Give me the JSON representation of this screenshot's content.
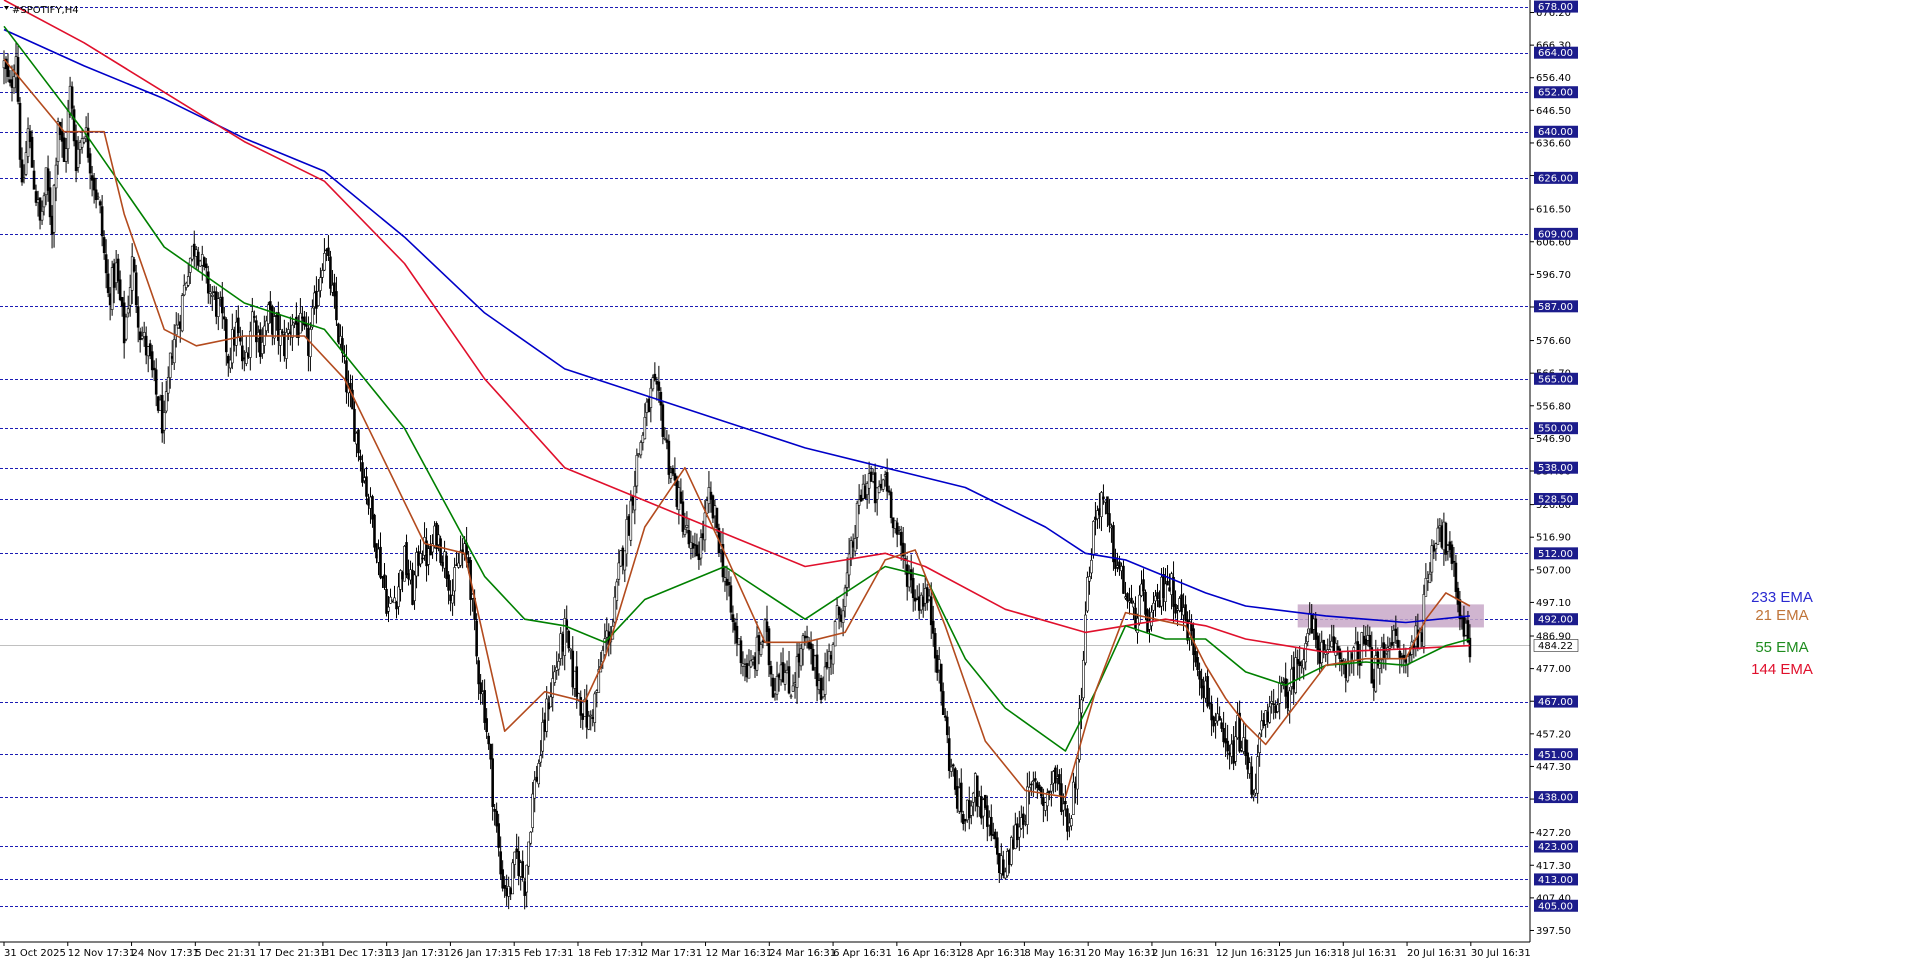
{
  "title": "#SPOTIFY,H4",
  "chart_data": {
    "type": "candlestick",
    "symbol": "#SPOTIFY",
    "timeframe": "H4",
    "ylim": [
      394.0,
      680.0
    ],
    "price_ticks": [
      "676.20",
      "666.30",
      "656.40",
      "646.50",
      "636.60",
      "626.70",
      "616.50",
      "606.60",
      "596.70",
      "586.80",
      "576.60",
      "566.70",
      "556.80",
      "546.90",
      "537.00",
      "526.80",
      "516.90",
      "507.00",
      "497.10",
      "486.90",
      "477.00",
      "467.10",
      "457.20",
      "447.30",
      "437.40",
      "427.20",
      "417.30",
      "407.40",
      "397.50"
    ],
    "x_labels": [
      "31 Oct 2025",
      "12 Nov 17:31",
      "24 Nov 17:31",
      "5 Dec 21:31",
      "17 Dec 21:31",
      "31 Dec 17:31",
      "13 Jan 17:31",
      "26 Jan 17:31",
      "5 Feb 17:31",
      "18 Feb 17:31",
      "2 Mar 17:31",
      "12 Mar 16:31",
      "24 Mar 16:31",
      "6 Apr 16:31",
      "16 Apr 16:31",
      "28 Apr 16:31",
      "8 May 16:31",
      "20 May 16:31",
      "2 Jun 16:31",
      "12 Jun 16:31",
      "25 Jun 16:31",
      "8 Jul 16:31",
      "20 Jul 16:31",
      "30 Jul 16:31"
    ],
    "horizontal_levels": [
      "678.00",
      "664.00",
      "652.00",
      "640.00",
      "626.00",
      "609.00",
      "587.00",
      "565.00",
      "550.00",
      "538.00",
      "528.50",
      "512.00",
      "492.00",
      "467.00",
      "451.00",
      "438.00",
      "423.00",
      "413.00",
      "405.00"
    ],
    "current_price": "484.22",
    "price_path": [
      [
        0,
        660
      ],
      [
        3,
        652
      ],
      [
        6,
        665
      ],
      [
        9,
        620
      ],
      [
        12,
        640
      ],
      [
        15,
        625
      ],
      [
        18,
        612
      ],
      [
        21,
        625
      ],
      [
        24,
        612
      ],
      [
        27,
        645
      ],
      [
        30,
        630
      ],
      [
        33,
        652
      ],
      [
        36,
        632
      ],
      [
        40,
        642
      ],
      [
        44,
        628
      ],
      [
        48,
        615
      ],
      [
        52,
        590
      ],
      [
        56,
        598
      ],
      [
        60,
        578
      ],
      [
        64,
        600
      ],
      [
        68,
        580
      ],
      [
        72,
        572
      ],
      [
        76,
        560
      ],
      [
        80,
        550
      ],
      [
        84,
        575
      ],
      [
        88,
        585
      ],
      [
        92,
        600
      ],
      [
        96,
        607
      ],
      [
        100,
        596
      ],
      [
        104,
        590
      ],
      [
        108,
        585
      ],
      [
        112,
        572
      ],
      [
        116,
        580
      ],
      [
        120,
        568
      ],
      [
        124,
        585
      ],
      [
        128,
        576
      ],
      [
        132,
        584
      ],
      [
        136,
        580
      ],
      [
        140,
        575
      ],
      [
        144,
        583
      ],
      [
        148,
        580
      ],
      [
        152,
        575
      ],
      [
        156,
        590
      ],
      [
        160,
        606
      ],
      [
        164,
        590
      ],
      [
        168,
        575
      ],
      [
        172,
        560
      ],
      [
        176,
        548
      ],
      [
        180,
        535
      ],
      [
        184,
        522
      ],
      [
        188,
        508
      ],
      [
        192,
        495
      ],
      [
        196,
        500
      ],
      [
        200,
        510
      ],
      [
        204,
        500
      ],
      [
        208,
        515
      ],
      [
        212,
        510
      ],
      [
        216,
        518
      ],
      [
        220,
        510
      ],
      [
        224,
        500
      ],
      [
        228,
        512
      ],
      [
        232,
        510
      ],
      [
        236,
        480
      ],
      [
        240,
        465
      ],
      [
        244,
        440
      ],
      [
        248,
        415
      ],
      [
        252,
        408
      ],
      [
        256,
        420
      ],
      [
        260,
        412
      ],
      [
        264,
        438
      ],
      [
        268,
        452
      ],
      [
        272,
        468
      ],
      [
        276,
        478
      ],
      [
        280,
        488
      ],
      [
        284,
        475
      ],
      [
        288,
        467
      ],
      [
        292,
        460
      ],
      [
        296,
        470
      ],
      [
        300,
        485
      ],
      [
        304,
        490
      ],
      [
        308,
        510
      ],
      [
        312,
        522
      ],
      [
        316,
        540
      ],
      [
        320,
        552
      ],
      [
        324,
        562
      ],
      [
        328,
        555
      ],
      [
        332,
        540
      ],
      [
        336,
        530
      ],
      [
        340,
        520
      ],
      [
        344,
        510
      ],
      [
        348,
        515
      ],
      [
        352,
        528
      ],
      [
        356,
        520
      ],
      [
        360,
        505
      ],
      [
        364,
        490
      ],
      [
        368,
        482
      ],
      [
        372,
        475
      ],
      [
        376,
        482
      ],
      [
        380,
        488
      ],
      [
        384,
        472
      ],
      [
        388,
        480
      ],
      [
        392,
        470
      ],
      [
        396,
        478
      ],
      [
        400,
        485
      ],
      [
        404,
        478
      ],
      [
        408,
        472
      ],
      [
        412,
        480
      ],
      [
        416,
        492
      ],
      [
        420,
        500
      ],
      [
        424,
        515
      ],
      [
        428,
        530
      ],
      [
        432,
        535
      ],
      [
        436,
        528
      ],
      [
        440,
        536
      ],
      [
        444,
        524
      ],
      [
        448,
        512
      ],
      [
        452,
        505
      ],
      [
        456,
        498
      ],
      [
        460,
        500
      ],
      [
        464,
        490
      ],
      [
        468,
        470
      ],
      [
        472,
        450
      ],
      [
        476,
        438
      ],
      [
        480,
        430
      ],
      [
        484,
        442
      ],
      [
        488,
        435
      ],
      [
        492,
        428
      ],
      [
        496,
        420
      ],
      [
        500,
        415
      ],
      [
        504,
        425
      ],
      [
        508,
        432
      ],
      [
        512,
        438
      ],
      [
        516,
        443
      ],
      [
        520,
        436
      ],
      [
        524,
        445
      ],
      [
        528,
        438
      ],
      [
        532,
        430
      ],
      [
        536,
        450
      ],
      [
        540,
        495
      ],
      [
        544,
        520
      ],
      [
        548,
        530
      ],
      [
        552,
        518
      ],
      [
        556,
        508
      ],
      [
        560,
        500
      ],
      [
        564,
        492
      ],
      [
        568,
        498
      ],
      [
        572,
        490
      ],
      [
        576,
        496
      ],
      [
        580,
        505
      ],
      [
        584,
        500
      ],
      [
        588,
        495
      ],
      [
        592,
        488
      ],
      [
        596,
        480
      ],
      [
        600,
        470
      ],
      [
        604,
        462
      ],
      [
        608,
        455
      ],
      [
        612,
        448
      ],
      [
        616,
        458
      ],
      [
        620,
        450
      ],
      [
        624,
        440
      ],
      [
        628,
        458
      ],
      [
        632,
        462
      ],
      [
        636,
        470
      ],
      [
        640,
        468
      ],
      [
        644,
        475
      ],
      [
        648,
        482
      ],
      [
        652,
        490
      ],
      [
        656,
        485
      ],
      [
        660,
        478
      ],
      [
        664,
        484
      ],
      [
        668,
        480
      ],
      [
        672,
        478
      ],
      [
        676,
        482
      ],
      [
        680,
        485
      ],
      [
        684,
        475
      ],
      [
        688,
        480
      ],
      [
        692,
        488
      ],
      [
        696,
        482
      ],
      [
        700,
        478
      ],
      [
        704,
        486
      ],
      [
        708,
        490
      ],
      [
        712,
        510
      ],
      [
        716,
        522
      ],
      [
        720,
        515
      ],
      [
        724,
        505
      ],
      [
        728,
        492
      ],
      [
        732,
        484
      ]
    ],
    "series": [
      {
        "name": "233 EMA",
        "color": "#0000c8",
        "values": [
          [
            0,
            671
          ],
          [
            40,
            660
          ],
          [
            80,
            650
          ],
          [
            120,
            638
          ],
          [
            160,
            628
          ],
          [
            200,
            608
          ],
          [
            240,
            585
          ],
          [
            280,
            568
          ],
          [
            320,
            560
          ],
          [
            360,
            552
          ],
          [
            400,
            544
          ],
          [
            440,
            538
          ],
          [
            480,
            532
          ],
          [
            520,
            520
          ],
          [
            540,
            512
          ],
          [
            560,
            510
          ],
          [
            580,
            505
          ],
          [
            600,
            500
          ],
          [
            620,
            496
          ],
          [
            660,
            493
          ],
          [
            700,
            491
          ],
          [
            732,
            493
          ]
        ]
      },
      {
        "name": "144 EMA",
        "color": "#e0102c",
        "values": [
          [
            0,
            680
          ],
          [
            40,
            667
          ],
          [
            80,
            652
          ],
          [
            120,
            637
          ],
          [
            160,
            625
          ],
          [
            200,
            600
          ],
          [
            240,
            565
          ],
          [
            280,
            538
          ],
          [
            320,
            528
          ],
          [
            360,
            518
          ],
          [
            400,
            508
          ],
          [
            440,
            512
          ],
          [
            460,
            508
          ],
          [
            500,
            495
          ],
          [
            540,
            488
          ],
          [
            560,
            490
          ],
          [
            580,
            492
          ],
          [
            600,
            490
          ],
          [
            620,
            486
          ],
          [
            660,
            482
          ],
          [
            700,
            483
          ],
          [
            732,
            484
          ]
        ]
      },
      {
        "name": "55 EMA",
        "color": "#008000",
        "values": [
          [
            0,
            672
          ],
          [
            40,
            640
          ],
          [
            80,
            605
          ],
          [
            120,
            588
          ],
          [
            160,
            580
          ],
          [
            200,
            550
          ],
          [
            240,
            505
          ],
          [
            260,
            492
          ],
          [
            280,
            490
          ],
          [
            300,
            485
          ],
          [
            320,
            498
          ],
          [
            360,
            508
          ],
          [
            400,
            492
          ],
          [
            440,
            508
          ],
          [
            460,
            505
          ],
          [
            480,
            480
          ],
          [
            500,
            465
          ],
          [
            530,
            452
          ],
          [
            545,
            470
          ],
          [
            560,
            490
          ],
          [
            580,
            486
          ],
          [
            600,
            486
          ],
          [
            620,
            476
          ],
          [
            640,
            472
          ],
          [
            660,
            478
          ],
          [
            680,
            479
          ],
          [
            700,
            478
          ],
          [
            720,
            484
          ],
          [
            732,
            486
          ]
        ]
      },
      {
        "name": "21 EMA",
        "color": "#b34b1e",
        "values": [
          [
            0,
            662
          ],
          [
            30,
            640
          ],
          [
            50,
            640
          ],
          [
            60,
            615
          ],
          [
            80,
            580
          ],
          [
            96,
            575
          ],
          [
            120,
            578
          ],
          [
            150,
            578
          ],
          [
            170,
            565
          ],
          [
            190,
            540
          ],
          [
            210,
            515
          ],
          [
            230,
            512
          ],
          [
            250,
            458
          ],
          [
            270,
            470
          ],
          [
            290,
            467
          ],
          [
            300,
            480
          ],
          [
            320,
            520
          ],
          [
            340,
            538
          ],
          [
            360,
            512
          ],
          [
            380,
            485
          ],
          [
            400,
            485
          ],
          [
            420,
            488
          ],
          [
            440,
            510
          ],
          [
            455,
            513
          ],
          [
            470,
            490
          ],
          [
            490,
            455
          ],
          [
            510,
            440
          ],
          [
            530,
            438
          ],
          [
            545,
            470
          ],
          [
            560,
            494
          ],
          [
            575,
            492
          ],
          [
            590,
            490
          ],
          [
            600,
            478
          ],
          [
            610,
            468
          ],
          [
            620,
            460
          ],
          [
            630,
            454
          ],
          [
            640,
            462
          ],
          [
            660,
            478
          ],
          [
            680,
            480
          ],
          [
            700,
            480
          ],
          [
            710,
            492
          ],
          [
            720,
            500
          ],
          [
            732,
            496
          ]
        ]
      }
    ],
    "legend": [
      {
        "text": "233 EMA",
        "color": "#2a2ad0"
      },
      {
        "text": "21 EMA",
        "color": "#c07438"
      },
      {
        "text": "55 EMA",
        "color": "#1e8c1e"
      },
      {
        "text": "144 EMA",
        "color": "#e0102c"
      }
    ],
    "zone": {
      "from_price": 489.5,
      "to_price": 496.5,
      "from_x": 646,
      "to_x": 732,
      "color": "#c8a8c8"
    }
  }
}
